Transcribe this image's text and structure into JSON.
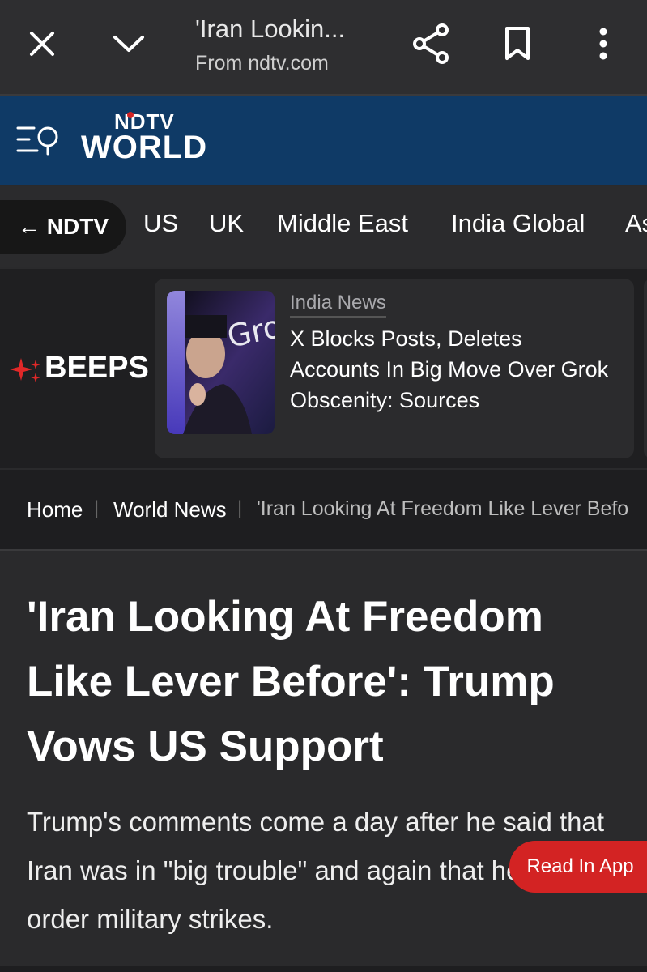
{
  "browser": {
    "title": "'Iran Lookin...",
    "subtitle": "From ndtv.com"
  },
  "brand": {
    "top": "NDTV",
    "bottom": "WORLD"
  },
  "nav": {
    "back_label": "← NDTV",
    "items": [
      "US",
      "UK",
      "Middle East",
      "India Global",
      "As"
    ]
  },
  "beeps": {
    "label": "BEEPS",
    "category": "India News",
    "headline": "X Blocks Posts, Deletes Accounts In Big Move Over Grok Obscenity: Sources",
    "image_text": "Gro"
  },
  "breadcrumb": {
    "home": "Home",
    "section": "World News",
    "current": "'Iran Looking At Freedom Like Lever Befo"
  },
  "article": {
    "headline": "'Iran Looking At Freedom Like Lever Before': Trump Vows US Support",
    "summary": "Trump's comments come a day after he said that Iran was in \"big trouble\" and again that he could order military strikes."
  },
  "read_in_app": "Read In App",
  "colors": {
    "brand_blue": "#0f3a66",
    "accent_red": "#d32323"
  }
}
